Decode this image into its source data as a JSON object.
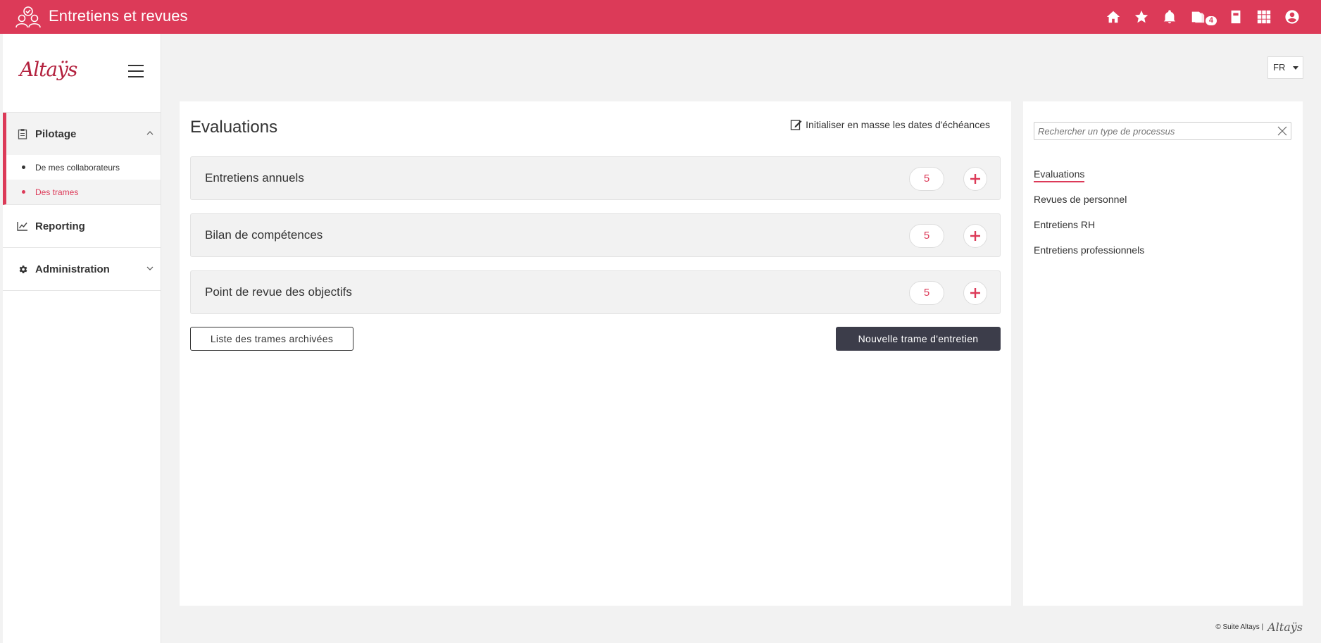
{
  "header": {
    "title": "Entretiens et revues",
    "notification_count": "4",
    "icons": [
      "home-icon",
      "star-icon",
      "bell-icon",
      "notes-icon",
      "book-icon",
      "apps-grid-icon",
      "user-account-icon"
    ],
    "bg_color": "#dc3a58"
  },
  "sidebar": {
    "logo_text": "Altaÿs",
    "sections": [
      {
        "label": "Pilotage",
        "icon": "clipboard-icon",
        "expanded": true,
        "items": [
          {
            "label": "De mes collaborateurs",
            "selected": false
          },
          {
            "label": "Des trames",
            "selected": true
          }
        ]
      },
      {
        "label": "Reporting",
        "icon": "chart-line-icon"
      },
      {
        "label": "Administration",
        "icon": "cog-icon",
        "expanded": false
      }
    ]
  },
  "language": {
    "selected": "FR"
  },
  "main": {
    "title": "Evaluations",
    "bulk_action": "Initialiser en masse les dates d'échéances",
    "cards": [
      {
        "label": "Entretiens annuels",
        "count": "5"
      },
      {
        "label": "Bilan de compétences",
        "count": "5"
      },
      {
        "label": "Point de revue des objectifs",
        "count": "5"
      }
    ],
    "archive_button": "Liste des trames archivées",
    "new_button": "Nouvelle trame d'entretien"
  },
  "side": {
    "search_placeholder": "Rechercher un type de processus",
    "types": [
      {
        "label": "Evaluations",
        "active": true
      },
      {
        "label": "Revues de personnel",
        "active": false
      },
      {
        "label": "Entretiens RH",
        "active": false
      },
      {
        "label": "Entretiens professionnels",
        "active": false
      }
    ]
  },
  "footer": {
    "text": "© Suite Altays |",
    "logo_text": "Altaÿs"
  },
  "colors": {
    "accent": "#dc3a58",
    "dark_button": "#3c3d4a"
  }
}
